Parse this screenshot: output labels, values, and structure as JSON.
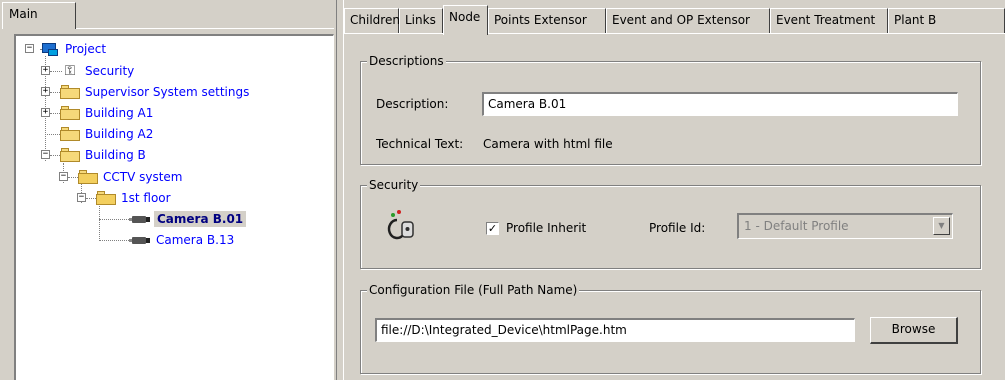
{
  "left": {
    "tab_label": "Main",
    "tree": [
      {
        "label": "Project",
        "icon": "project-icon",
        "expander": "−"
      },
      {
        "label": "Security",
        "icon": "security-key-icon",
        "expander": "+"
      },
      {
        "label": "Supervisor System settings",
        "icon": "folder-icon",
        "expander": "+"
      },
      {
        "label": "Building A1",
        "icon": "folder-icon",
        "expander": "+"
      },
      {
        "label": "Building A2",
        "icon": "folder-icon"
      },
      {
        "label": "Building B",
        "icon": "folder-icon",
        "expander": "−"
      },
      {
        "label": "CCTV system",
        "icon": "folder-open-icon",
        "expander": "−"
      },
      {
        "label": "1st floor",
        "icon": "folder-open-icon",
        "expander": "−"
      },
      {
        "label": "Camera B.01",
        "icon": "camera-icon",
        "selected": true
      },
      {
        "label": "Camera B.13",
        "icon": "camera-icon"
      }
    ]
  },
  "tabs": [
    "Children",
    "Links",
    "Node",
    "Points Extensor",
    "Event and OP Extensor",
    "Event Treatment",
    "Plant B"
  ],
  "active_tab": "Node",
  "descriptions": {
    "legend": "Descriptions",
    "description_label": "Description:",
    "description_value": "Camera B.01",
    "technical_label": "Technical Text:",
    "technical_value": "Camera with html file"
  },
  "security": {
    "legend": "Security",
    "icon": "security-key-icon",
    "profile_inherit_label": "Profile Inherit",
    "profile_inherit_checked": "✓",
    "profile_id_label": "Profile Id:",
    "profile_id_value": "1 - Default Profile"
  },
  "config": {
    "legend": "Configuration File (Full Path Name)",
    "path_value": "file://D:\\Integrated_Device\\htmlPage.htm",
    "browse_label": "Browse"
  },
  "colors": {
    "window_bg": "#d4d0c8",
    "tree_link": "#0000ff",
    "selected_text": "#000080"
  }
}
